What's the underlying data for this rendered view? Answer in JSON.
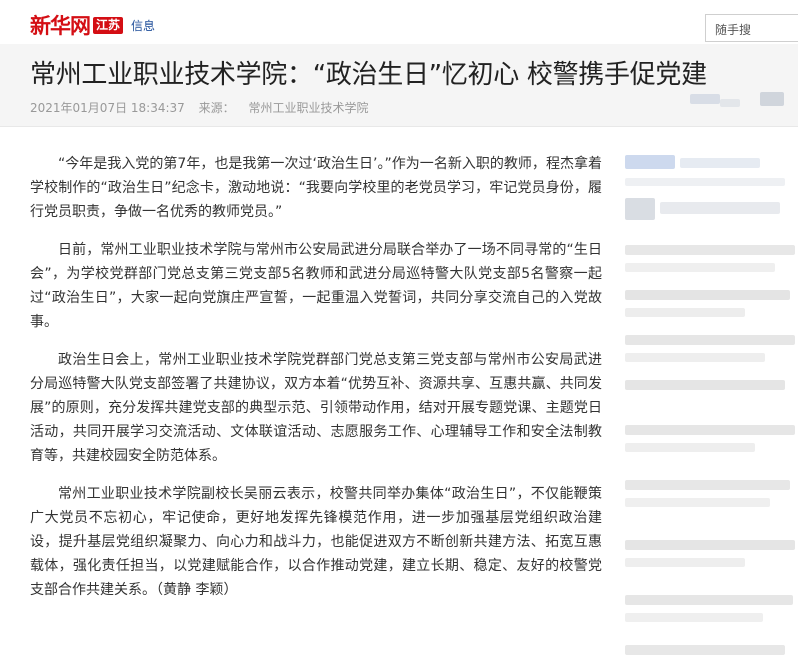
{
  "header": {
    "logo_main": "新华网",
    "logo_region": "江苏",
    "logo_sub": "信息",
    "search_placeholder": "随手搜"
  },
  "article": {
    "title": "常州工业职业技术学院：“政治生日”忆初心 校警携手促党建",
    "datetime": "2021年01月07日 18:34:37",
    "source_label": "来源：",
    "source": "常州工业职业技术学院",
    "paragraphs": [
      "“今年是我入党的第7年，也是我第一次过‘政治生日’。”作为一名新入职的教师，程杰拿着学校制作的“政治生日”纪念卡，激动地说：“我要向学校里的老党员学习，牢记党员身份，履行党员职责，争做一名优秀的教师党员。”",
      "日前，常州工业职业技术学院与常州市公安局武进分局联合举办了一场不同寻常的“生日会”，为学校党群部门党总支第三党支部5名教师和武进分局巡特警大队党支部5名警察一起过“政治生日”，大家一起向党旗庄严宣誓，一起重温入党誓词，共同分享交流自己的入党故事。",
      "政治生日会上，常州工业职业技术学院党群部门党总支第三党支部与常州市公安局武进分局巡特警大队党支部签署了共建协议，双方本着“优势互补、资源共享、互惠共赢、共同发展”的原则，充分发挥共建党支部的典型示范、引领带动作用，结对开展专题党课、主题党日活动，共同开展学习交流活动、文体联谊活动、志愿服务工作、心理辅导工作和安全法制教育等，共建校园安全防范体系。",
      "常州工业职业技术学院副校长吴丽云表示，校警共同举办集体“政治生日”，不仅能鞭策广大党员不忘初心，牢记使命，更好地发挥先锋模范作用，进一步加强基层党组织政治建设，提升基层党组织凝聚力、向心力和战斗力，也能促进双方不断创新共建方法、拓宽互惠载体，强化责任担当，以党建赋能合作，以合作推动党建，建立长期、稳定、友好的校警党支部合作共建关系。（黄静 李颖）"
    ]
  },
  "colors": {
    "brand_red": "#d40e14",
    "link_blue": "#1f4e9a",
    "title_band": "#f5f5f5"
  }
}
